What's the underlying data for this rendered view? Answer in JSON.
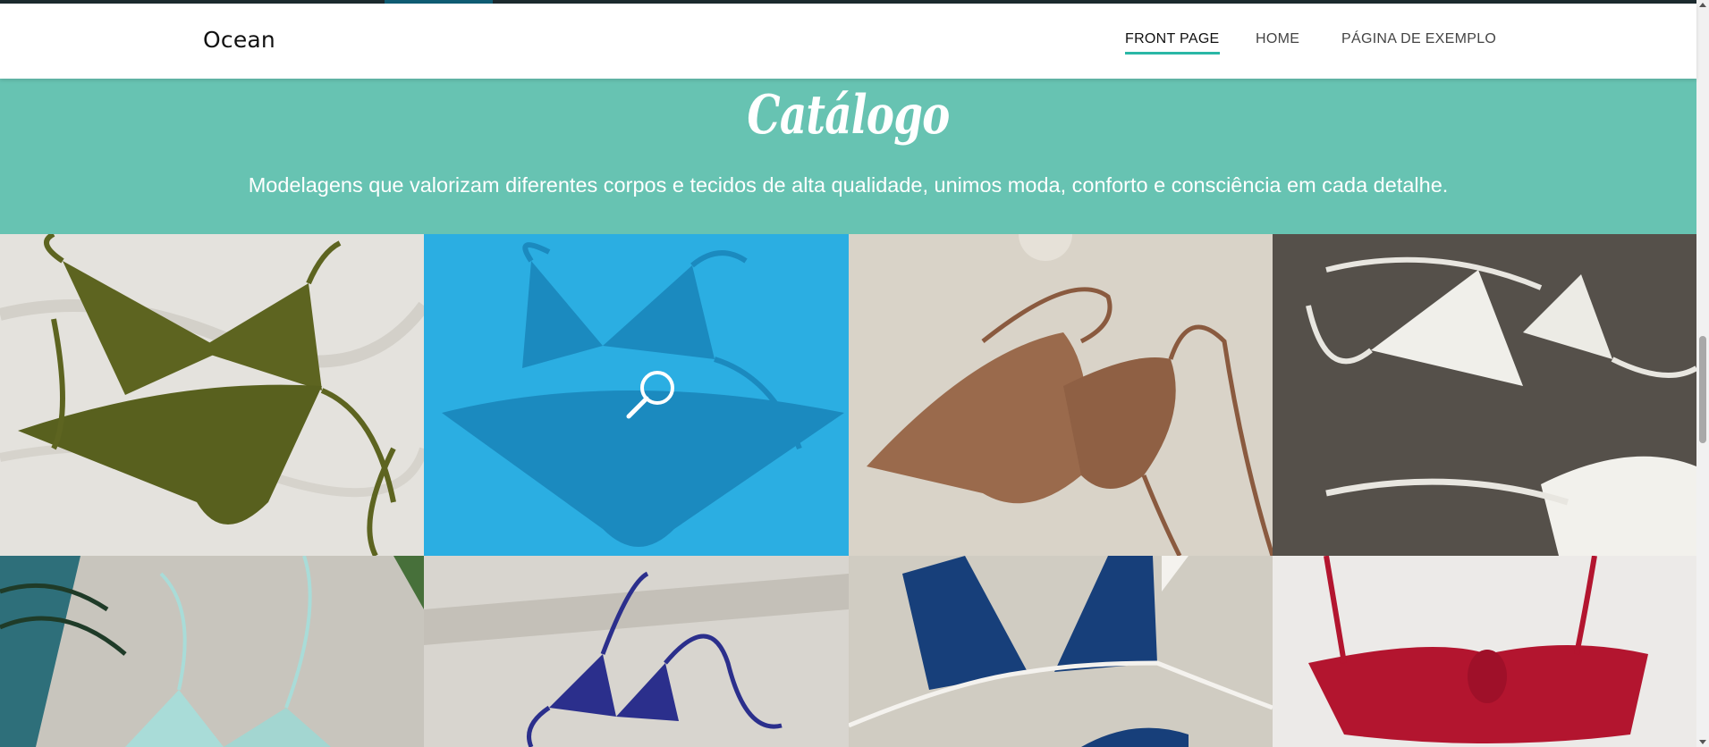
{
  "header": {
    "logo": "Ocean",
    "nav": [
      {
        "label": "FRONT PAGE",
        "active": true
      },
      {
        "label": "HOME",
        "active": false
      },
      {
        "label": "PÁGINA DE EXEMPLO",
        "active": false
      }
    ]
  },
  "hero": {
    "title": "Catálogo",
    "subtitle": "Modelagens que valorizam diferentes corpos e tecidos de alta qualidade, unimos moda, conforto e consciência em cada detalhe."
  },
  "gallery": {
    "items": [
      {
        "name": "olive-bikini",
        "color": "#5d6420",
        "background": "#e4e2dd"
      },
      {
        "name": "blue-bikini-hover",
        "color": "#1f4f7a",
        "background": "#5cb8d8",
        "hovered": true
      },
      {
        "name": "bronze-bikini",
        "color": "#9a6a4c",
        "background": "#d9d3c8"
      },
      {
        "name": "white-bikini",
        "color": "#f0efea",
        "background": "#55504a"
      },
      {
        "name": "mint-bikini",
        "color": "#a9dcd8",
        "background": "#c8c5bd"
      },
      {
        "name": "navy-string-bikini",
        "color": "#2b2f8c",
        "background": "#d8d5cf"
      },
      {
        "name": "navy-triangle-bikini",
        "color": "#173f7a",
        "background": "#d0ccc2"
      },
      {
        "name": "red-bandeau-bikini",
        "color": "#b3152f",
        "background": "#eceae8"
      }
    ]
  },
  "colors": {
    "hero_bg": "#67c3b2",
    "accent": "#2ab7a6",
    "hover_overlay": "#19aae6"
  },
  "icons": {
    "hover": "magnifier-icon"
  }
}
